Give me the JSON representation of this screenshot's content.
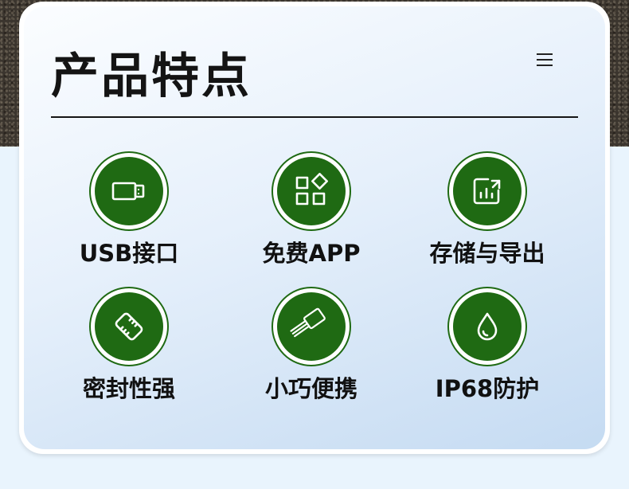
{
  "section": {
    "title": "产品特点"
  },
  "features": [
    {
      "label": "USB接口",
      "icon": "usb-drive-icon"
    },
    {
      "label": "免费APP",
      "icon": "app-grid-icon"
    },
    {
      "label": "存储与导出",
      "icon": "export-chart-icon"
    },
    {
      "label": "密封性强",
      "icon": "seal-capsule-icon"
    },
    {
      "label": "小巧便携",
      "icon": "probe-sensor-icon"
    },
    {
      "label": "IP68防护",
      "icon": "water-drop-icon"
    }
  ],
  "colors": {
    "badge_green": "#1f6a13",
    "title_text": "#141414",
    "card_gradient_end": "#c5dbf2"
  }
}
